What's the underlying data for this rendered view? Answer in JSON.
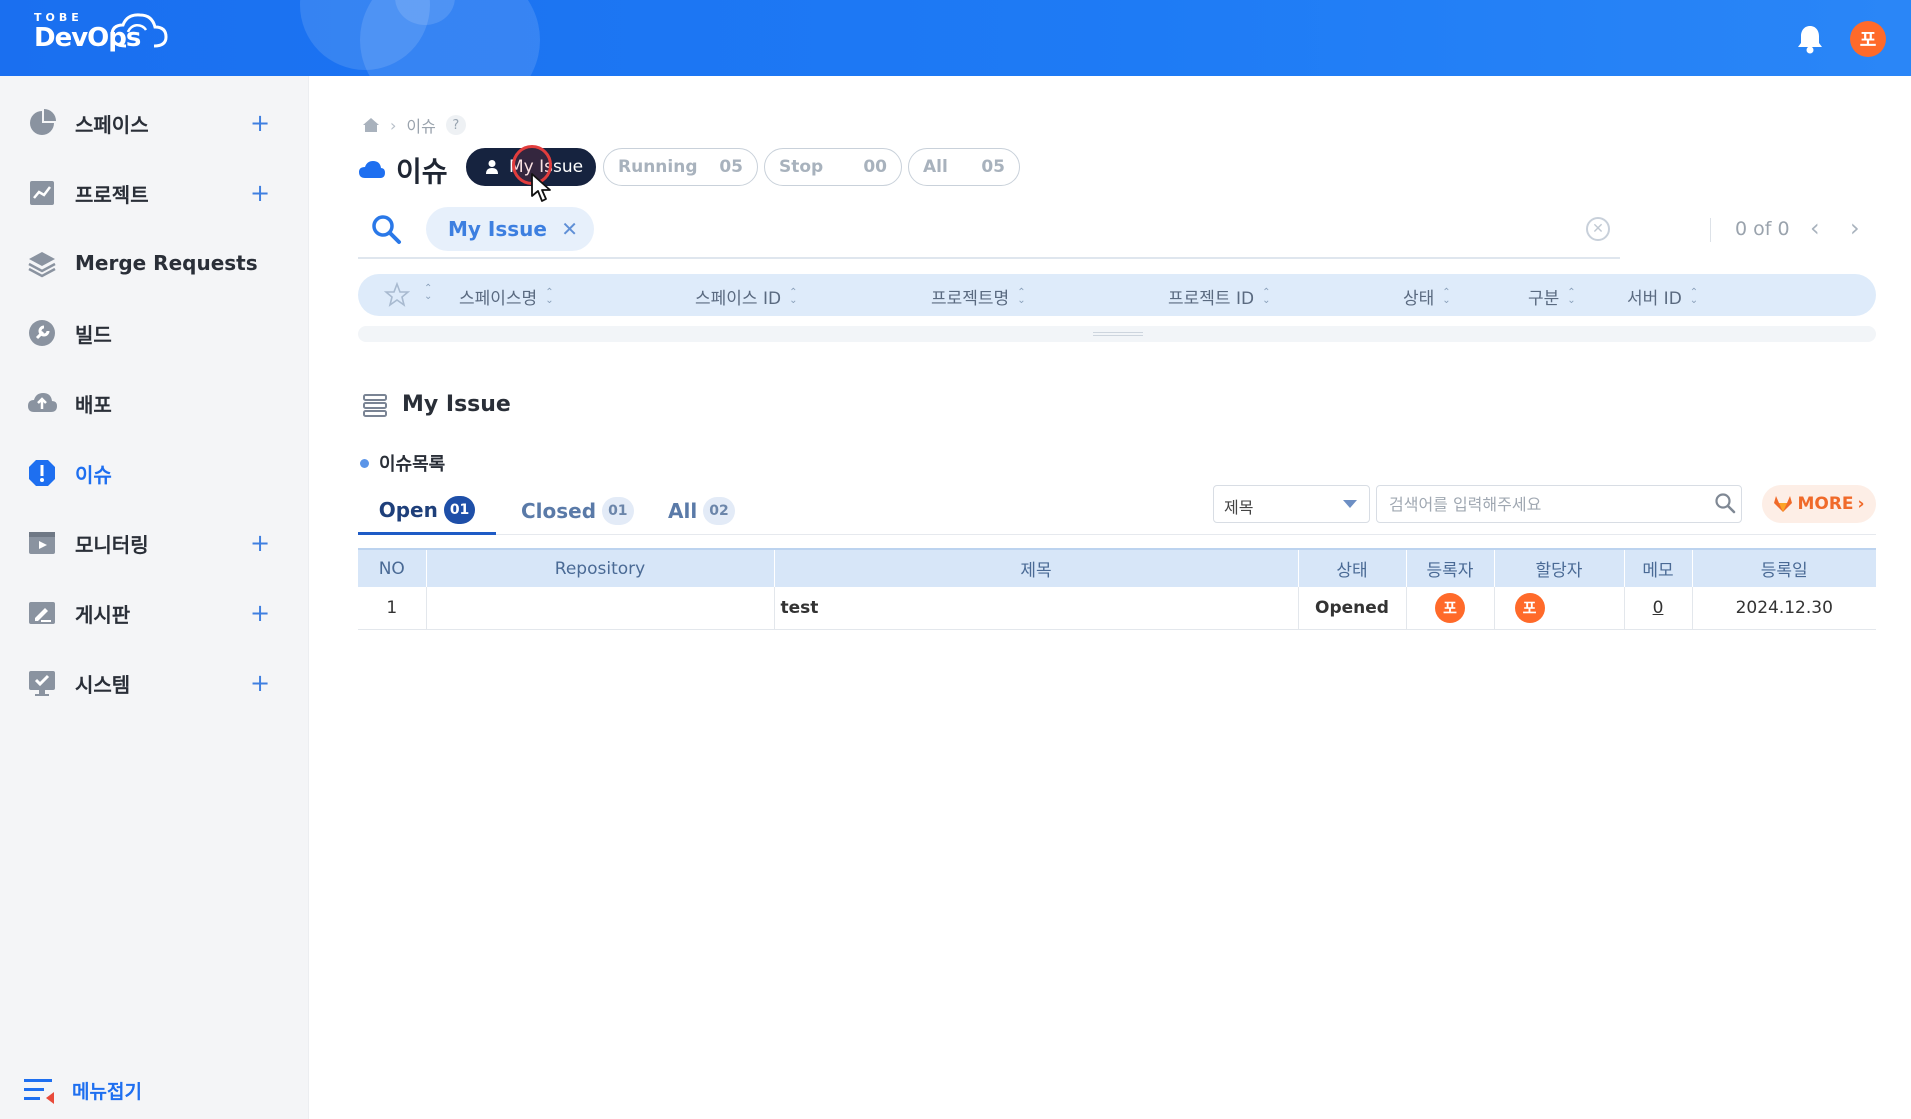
{
  "header": {
    "logo_top": "TOBE",
    "logo_main": "DevOps",
    "user_initial": "포"
  },
  "sidebar": {
    "items": [
      {
        "label": "스페이스",
        "plus": "+"
      },
      {
        "label": "프로젝트",
        "plus": "+"
      },
      {
        "label": "Merge Requests",
        "plus": ""
      },
      {
        "label": "빌드",
        "plus": ""
      },
      {
        "label": "배포",
        "plus": ""
      },
      {
        "label": "이슈",
        "plus": ""
      },
      {
        "label": "모니터링",
        "plus": "+"
      },
      {
        "label": "게시판",
        "plus": "+"
      },
      {
        "label": "시스템",
        "plus": "+"
      }
    ],
    "collapse_label": "메뉴접기"
  },
  "breadcrumb": {
    "current": "이슈",
    "help": "?"
  },
  "page": {
    "title": "이슈"
  },
  "chips": {
    "my_issue": "My Issue",
    "running": {
      "label": "Running",
      "count": "05"
    },
    "stop": {
      "label": "Stop",
      "count": "00"
    },
    "all": {
      "label": "All",
      "count": "05"
    }
  },
  "search": {
    "filter_chip": "My Issue",
    "filter_close": "✕",
    "clear": "✕",
    "pager_text": "0 of 0",
    "prev": "‹",
    "next": "›"
  },
  "grid_columns": [
    "스페이스명",
    "스페이스 ID",
    "프로젝트명",
    "프로젝트 ID",
    "상태",
    "구분",
    "서버 ID"
  ],
  "section": {
    "title": "My Issue",
    "subtitle": "이슈목록"
  },
  "tabs": [
    {
      "label": "Open",
      "count": "01"
    },
    {
      "label": "Closed",
      "count": "01"
    },
    {
      "label": "All",
      "count": "02"
    }
  ],
  "filter": {
    "select_value": "제목",
    "search_placeholder": "검색어를 입력해주세요",
    "more_label": "MORE"
  },
  "table": {
    "headers": [
      "NO",
      "Repository",
      "제목",
      "상태",
      "등록자",
      "할당자",
      "메모",
      "등록일"
    ],
    "rows": [
      {
        "no": "1",
        "repository": "",
        "title": "test",
        "status": "Opened",
        "registrant": "포",
        "assignee": "포",
        "memo": "0",
        "date": "2024.12.30"
      }
    ]
  },
  "colors": {
    "primary": "#1e6ff0",
    "dark_chip": "#16233f",
    "avatar": "#ff6a2a",
    "more": "#f06a2a"
  }
}
